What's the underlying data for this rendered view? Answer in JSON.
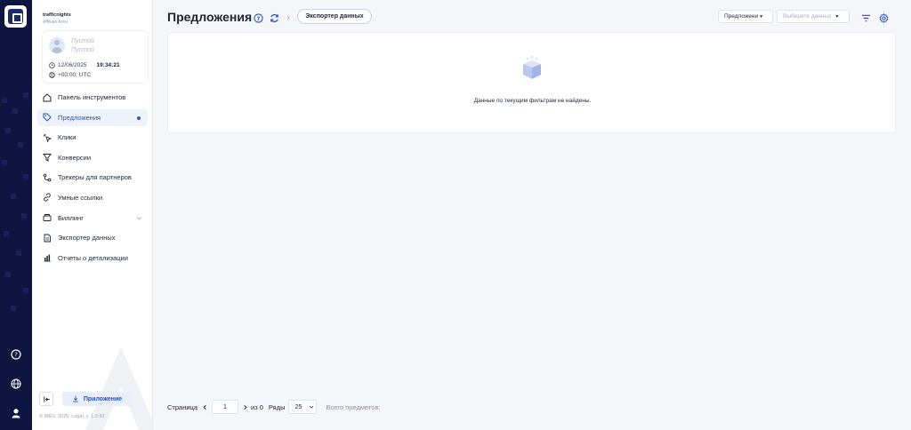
{
  "brand": {
    "name": "trafficnights",
    "subtitle": "Affiliate Area"
  },
  "user": {
    "name_line1": "Пустой",
    "name_line2": "Пустой",
    "date": "12/06/2025",
    "time": "19:34:21",
    "timezone": "+00:00, UTC"
  },
  "nav": {
    "items": [
      {
        "label": "Панель инструментов",
        "icon": "dashboard-icon"
      },
      {
        "label": "Предложения",
        "icon": "tag-icon",
        "active": true
      },
      {
        "label": "Клики",
        "icon": "click-icon"
      },
      {
        "label": "Конверсии",
        "icon": "filter-icon"
      },
      {
        "label": "Трекеры для партнеров",
        "icon": "tracker-icon"
      },
      {
        "label": "Умные ссылки",
        "icon": "link-icon"
      },
      {
        "label": "Биллинг",
        "icon": "billing-icon",
        "expandable": true
      },
      {
        "label": "Экспортер данных",
        "icon": "export-icon"
      },
      {
        "label": "Отчеты о детализации",
        "icon": "report-icon"
      }
    ]
  },
  "sidebar_footer": {
    "app_button": "Приложение",
    "copyright": "© IREV, 2025. Legal. v. 1.3.53"
  },
  "header": {
    "title": "Предложения",
    "export_button": "Экспортер данных",
    "offers_select": "Предложени",
    "data_select_placeholder": "Выберите данных"
  },
  "empty_state": {
    "message": "Данные по текущим фильтрам не найдены."
  },
  "pagination": {
    "page_label": "Страница",
    "page_value": "1",
    "of_label": "из 0",
    "rows_label": "Ряды",
    "rows_value": "25",
    "total_label": "Всего предметов:"
  },
  "colors": {
    "rail": "#0d1640",
    "accent": "#2a4fb8",
    "active_bg": "#eef2fb"
  }
}
